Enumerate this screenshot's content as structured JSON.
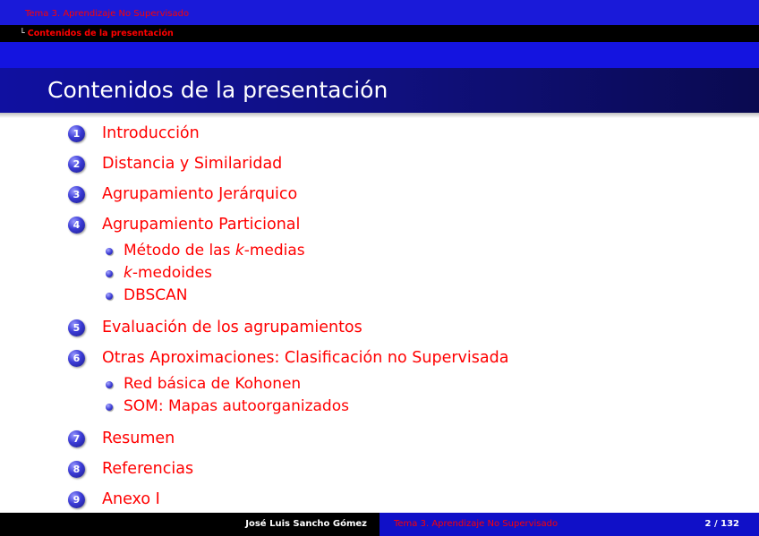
{
  "header": {
    "section": "Tema 3. Aprendizaje No Supervisado",
    "subsection": "Contenidos de la presentación"
  },
  "frame_title": "Contenidos de la presentación",
  "toc": [
    {
      "num": "1",
      "label": "Introducción"
    },
    {
      "num": "2",
      "label": "Distancia y Similaridad"
    },
    {
      "num": "3",
      "label": "Agrupamiento Jerárquico"
    },
    {
      "num": "4",
      "label": "Agrupamiento Particional",
      "subitems": [
        {
          "prefix": "Método de las ",
          "em": "k",
          "suffix": "-medias"
        },
        {
          "prefix": "",
          "em": "k",
          "suffix": "-medoides"
        },
        {
          "prefix": "DBSCAN",
          "em": "",
          "suffix": ""
        }
      ]
    },
    {
      "num": "5",
      "label": "Evaluación de los agrupamientos"
    },
    {
      "num": "6",
      "label": "Otras Aproximaciones: Clasificación no Supervisada",
      "subitems": [
        {
          "prefix": "Red básica de Kohonen",
          "em": "",
          "suffix": ""
        },
        {
          "prefix": "SOM: Mapas autoorganizados",
          "em": "",
          "suffix": ""
        }
      ]
    },
    {
      "num": "7",
      "label": "Resumen"
    },
    {
      "num": "8",
      "label": "Referencias"
    },
    {
      "num": "9",
      "label": "Anexo I"
    }
  ],
  "footer": {
    "author": "José Luis Sancho Gómez",
    "title": "Tema 3. Aprendizaje No Supervisado",
    "page": "2 / 132"
  }
}
